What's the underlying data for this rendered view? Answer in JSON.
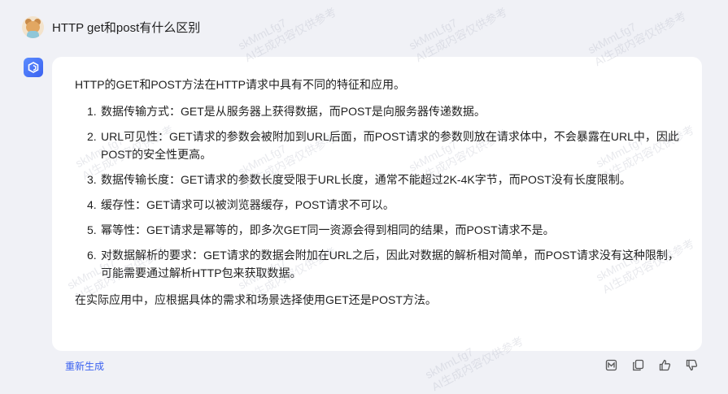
{
  "user_message": {
    "avatar_icon": "bear-avatar-icon",
    "text": "HTTP get和post有什么区别"
  },
  "assistant_message": {
    "avatar_icon": "assistant-logo-icon",
    "intro": "HTTP的GET和POST方法在HTTP请求中具有不同的特征和应用。",
    "items": [
      {
        "num": "1.",
        "text": "数据传输方式：GET是从服务器上获得数据，而POST是向服务器传递数据。"
      },
      {
        "num": "2.",
        "text": "URL可见性：GET请求的参数会被附加到URL后面，而POST请求的参数则放在请求体中，不会暴露在URL中，因此POST的安全性更高。"
      },
      {
        "num": "3.",
        "text": "数据传输长度：GET请求的参数长度受限于URL长度，通常不能超过2K-4K字节，而POST没有长度限制。"
      },
      {
        "num": "4.",
        "text": "缓存性：GET请求可以被浏览器缓存，POST请求不可以。"
      },
      {
        "num": "5.",
        "text": "幂等性：GET请求是幂等的，即多次GET同一资源会得到相同的结果，而POST请求不是。"
      },
      {
        "num": "6.",
        "text": "对数据解析的要求：GET请求的数据会附加在URL之后，因此对数据的解析相对简单，而POST请求没有这种限制，可能需要通过解析HTTP包来获取数据。"
      }
    ],
    "outro": "在实际应用中，应根据具体的需求和场景选择使用GET还是POST方法。"
  },
  "footer": {
    "regenerate_label": "重新生成",
    "action_icons": [
      "image-export-icon",
      "copy-icon",
      "thumbs-up-icon",
      "thumbs-down-icon"
    ]
  },
  "watermark": {
    "line1": "skMmLfg7",
    "line2": "AI生成内容仅供参考"
  },
  "colors": {
    "accent": "#3b62f0",
    "background": "#f0f1f6",
    "card": "#ffffff"
  }
}
